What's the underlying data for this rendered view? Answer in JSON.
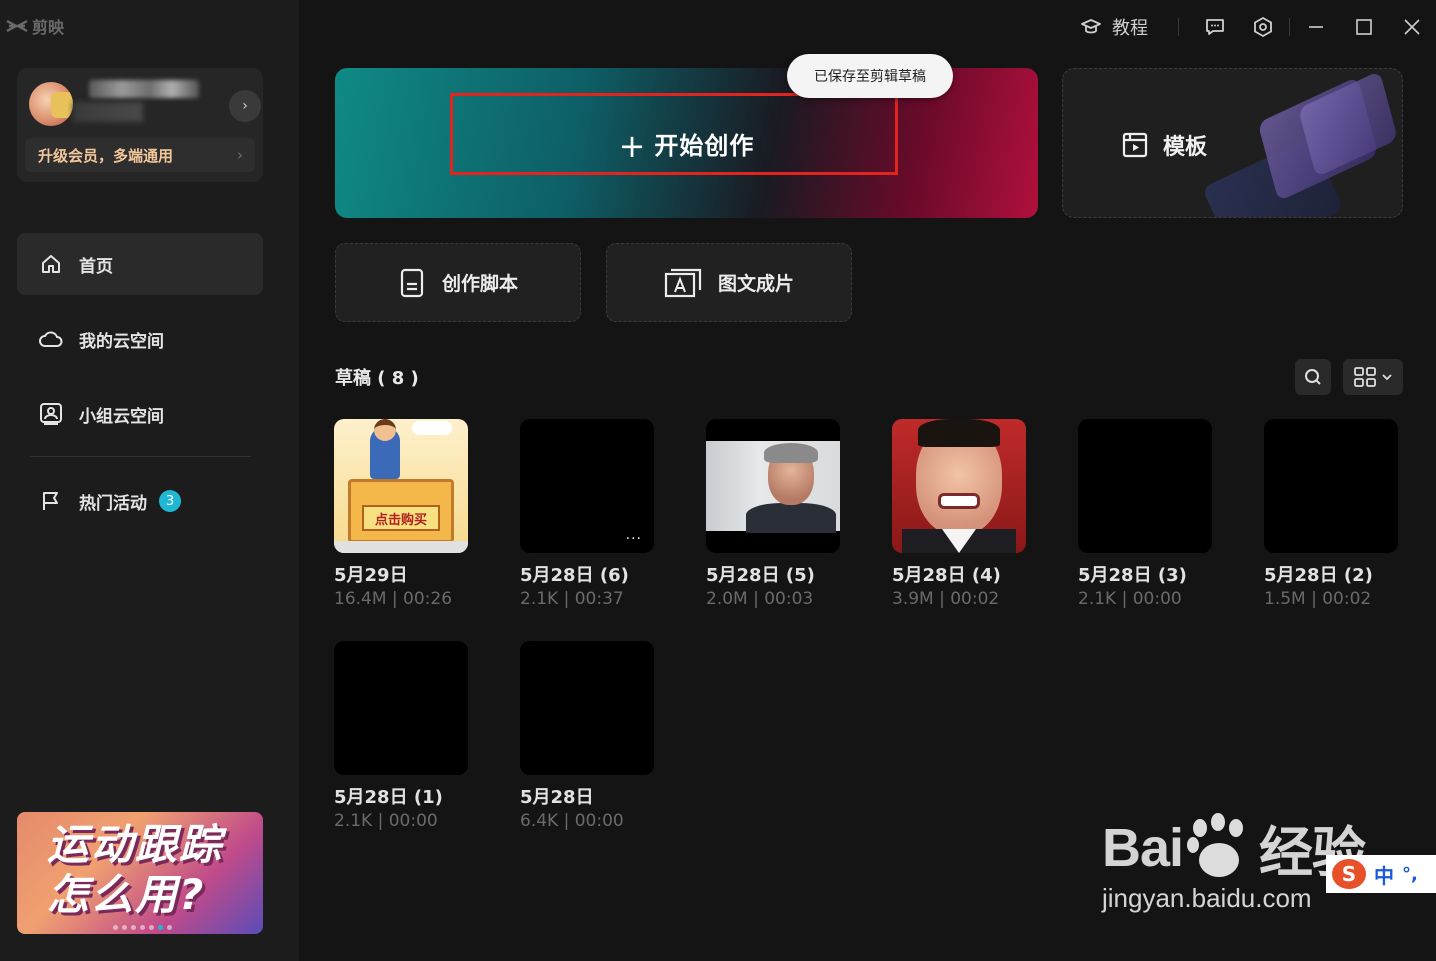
{
  "app": {
    "title": "剪映"
  },
  "profile": {
    "upgrade_label": "升级会员，多端通用",
    "chevron": "›"
  },
  "nav": {
    "items": [
      {
        "label": "首页",
        "icon": "home-icon",
        "active": true
      },
      {
        "label": "我的云空间",
        "icon": "cloud-icon",
        "active": false
      },
      {
        "label": "小组云空间",
        "icon": "group-cloud-icon",
        "active": false
      },
      {
        "label": "热门活动",
        "icon": "flag-icon",
        "active": false,
        "badge": "3"
      }
    ]
  },
  "promo": {
    "line1": "运动跟踪",
    "line2": "怎么用?"
  },
  "topbar": {
    "tutorial_label": "教程"
  },
  "main": {
    "create_label": "开始创作",
    "create_plus": "+",
    "saved_tip": "已保存至剪辑草稿",
    "template_label": "模板",
    "tools": [
      {
        "label": "创作脚本",
        "icon": "script-document-icon"
      },
      {
        "label": "图文成片",
        "icon": "text-to-video-icon"
      }
    ],
    "drafts_title": "草稿 ( 8 )"
  },
  "drafts": [
    {
      "name": "5月29日",
      "meta": "16.4M | 00:26",
      "art": "shop"
    },
    {
      "name": "5月28日 (6)",
      "meta": "2.1K | 00:37",
      "art": "black",
      "more": "..."
    },
    {
      "name": "5月28日 (5)",
      "meta": "2.0M | 00:03",
      "art": "man"
    },
    {
      "name": "5月28日 (4)",
      "meta": "3.9M | 00:02",
      "art": "face"
    },
    {
      "name": "5月28日 (3)",
      "meta": "2.1K | 00:00",
      "art": "black"
    },
    {
      "name": "5月28日 (2)",
      "meta": "1.5M | 00:02",
      "art": "black"
    },
    {
      "name": "5月28日 (1)",
      "meta": "2.1K | 00:00",
      "art": "black"
    },
    {
      "name": "5月28日",
      "meta": "6.4K | 00:00",
      "art": "black"
    }
  ],
  "shop_sign": "点击购买",
  "watermark": {
    "brand_left": "Bai",
    "brand_mid": "du",
    "brand_right": "经验",
    "url": "jingyan.baidu.com"
  },
  "ime": {
    "logo": "S",
    "mode": "中",
    "punct": "°,"
  },
  "colors": {
    "accent": "#1fb8d4",
    "highlight_box": "#e3231e",
    "vip_text": "#f2c79a"
  }
}
